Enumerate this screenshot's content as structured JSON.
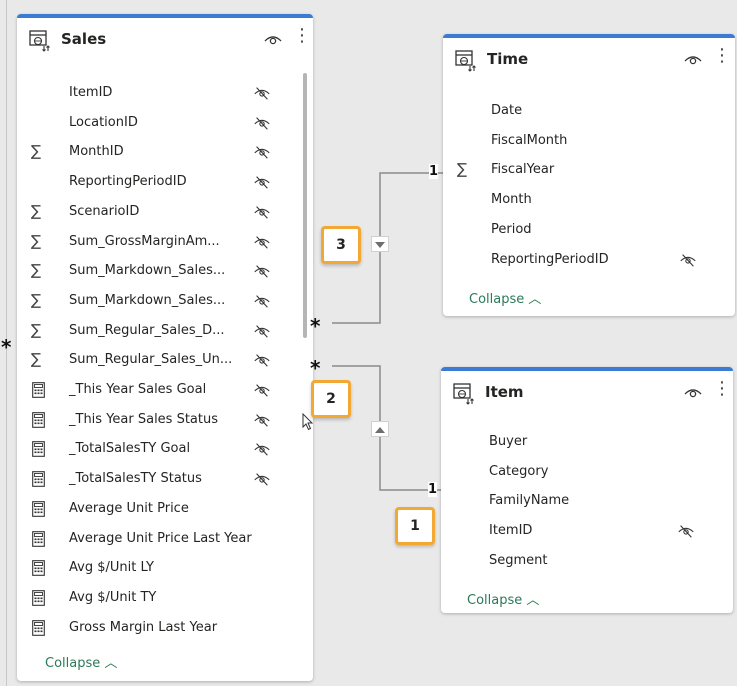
{
  "sales_table": {
    "title": "Sales",
    "icon": "table-icon",
    "fields": [
      {
        "name": "ItemID",
        "kind": "column",
        "hidden": true
      },
      {
        "name": "LocationID",
        "kind": "column",
        "hidden": true
      },
      {
        "name": "MonthID",
        "kind": "sum",
        "hidden": true
      },
      {
        "name": "ReportingPeriodID",
        "kind": "column",
        "hidden": true
      },
      {
        "name": "ScenarioID",
        "kind": "sum",
        "hidden": true
      },
      {
        "name": "Sum_GrossMarginAm...",
        "kind": "sum",
        "hidden": true
      },
      {
        "name": "Sum_Markdown_Sales...",
        "kind": "sum",
        "hidden": true
      },
      {
        "name": "Sum_Markdown_Sales...",
        "kind": "sum",
        "hidden": true
      },
      {
        "name": "Sum_Regular_Sales_D...",
        "kind": "sum",
        "hidden": true
      },
      {
        "name": "Sum_Regular_Sales_Un...",
        "kind": "sum",
        "hidden": true
      },
      {
        "name": "_This Year Sales Goal",
        "kind": "measure",
        "hidden": true
      },
      {
        "name": "_This Year Sales Status",
        "kind": "measure",
        "hidden": true
      },
      {
        "name": "_TotalSalesTY Goal",
        "kind": "measure",
        "hidden": true
      },
      {
        "name": "_TotalSalesTY Status",
        "kind": "measure",
        "hidden": true
      },
      {
        "name": "Average Unit Price",
        "kind": "measure",
        "hidden": false
      },
      {
        "name": "Average Unit Price Last Year",
        "kind": "measure",
        "hidden": false
      },
      {
        "name": "Avg $/Unit LY",
        "kind": "measure",
        "hidden": false
      },
      {
        "name": "Avg $/Unit TY",
        "kind": "measure",
        "hidden": false
      },
      {
        "name": "Gross Margin Last Year",
        "kind": "measure",
        "hidden": false
      }
    ],
    "collapse_label": "Collapse"
  },
  "time_table": {
    "title": "Time",
    "fields": [
      {
        "name": "Date",
        "kind": "column",
        "hidden": false
      },
      {
        "name": "FiscalMonth",
        "kind": "column",
        "hidden": false
      },
      {
        "name": "FiscalYear",
        "kind": "sum",
        "hidden": false
      },
      {
        "name": "Month",
        "kind": "column",
        "hidden": false
      },
      {
        "name": "Period",
        "kind": "column",
        "hidden": false
      },
      {
        "name": "ReportingPeriodID",
        "kind": "column",
        "hidden": true
      }
    ],
    "collapse_label": "Collapse"
  },
  "item_table": {
    "title": "Item",
    "fields": [
      {
        "name": "Buyer",
        "kind": "column",
        "hidden": false
      },
      {
        "name": "Category",
        "kind": "column",
        "hidden": false
      },
      {
        "name": "FamilyName",
        "kind": "column",
        "hidden": false
      },
      {
        "name": "ItemID",
        "kind": "column",
        "hidden": true
      },
      {
        "name": "Segment",
        "kind": "column",
        "hidden": false
      }
    ],
    "collapse_label": "Collapse"
  },
  "relationships": {
    "sales_time": {
      "many_label": "*",
      "one_label": "1",
      "callout": "3"
    },
    "sales_item": {
      "many_label": "*",
      "one_label": "1",
      "callout": "2"
    },
    "item_callout": "1",
    "left_edge_marker": "*"
  },
  "colors": {
    "card_accent": "#3b7bd4",
    "callout_border": "#f2a833",
    "collapse_text": "#2b7a5a"
  }
}
